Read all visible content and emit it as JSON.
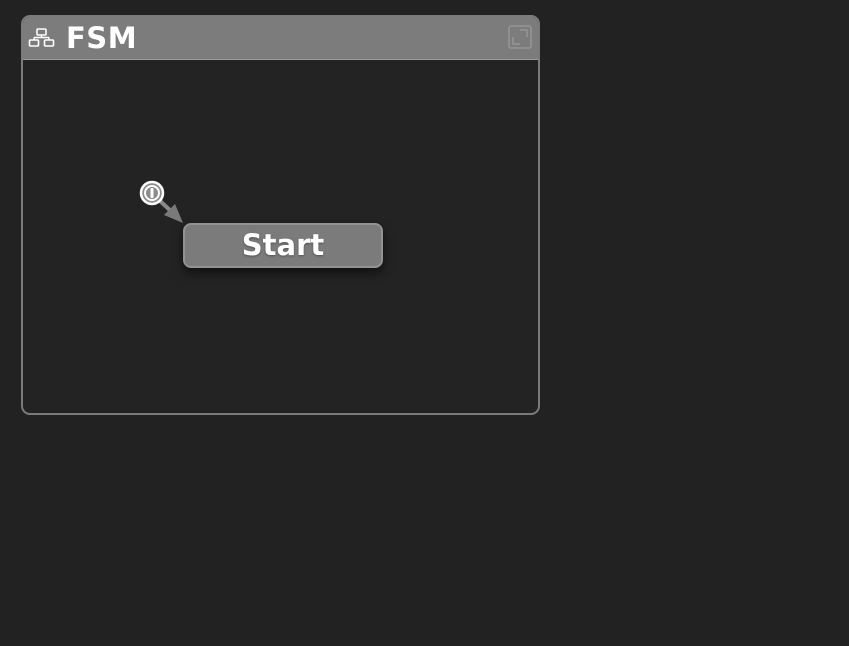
{
  "graph": {
    "title": "FSM",
    "icon": "state-machine-icon",
    "maximize_icon": "maximize-icon"
  },
  "states": [
    {
      "label": "Start",
      "is_entry": true
    }
  ],
  "entry": {
    "icon": "entry-point-icon",
    "target": "Start"
  },
  "colors": {
    "background": "#222222",
    "panel_background": "#232323",
    "header": "#7c7c7c",
    "border": "#7a7a7a",
    "node": "#7b7b7b",
    "text": "#ffffff"
  }
}
